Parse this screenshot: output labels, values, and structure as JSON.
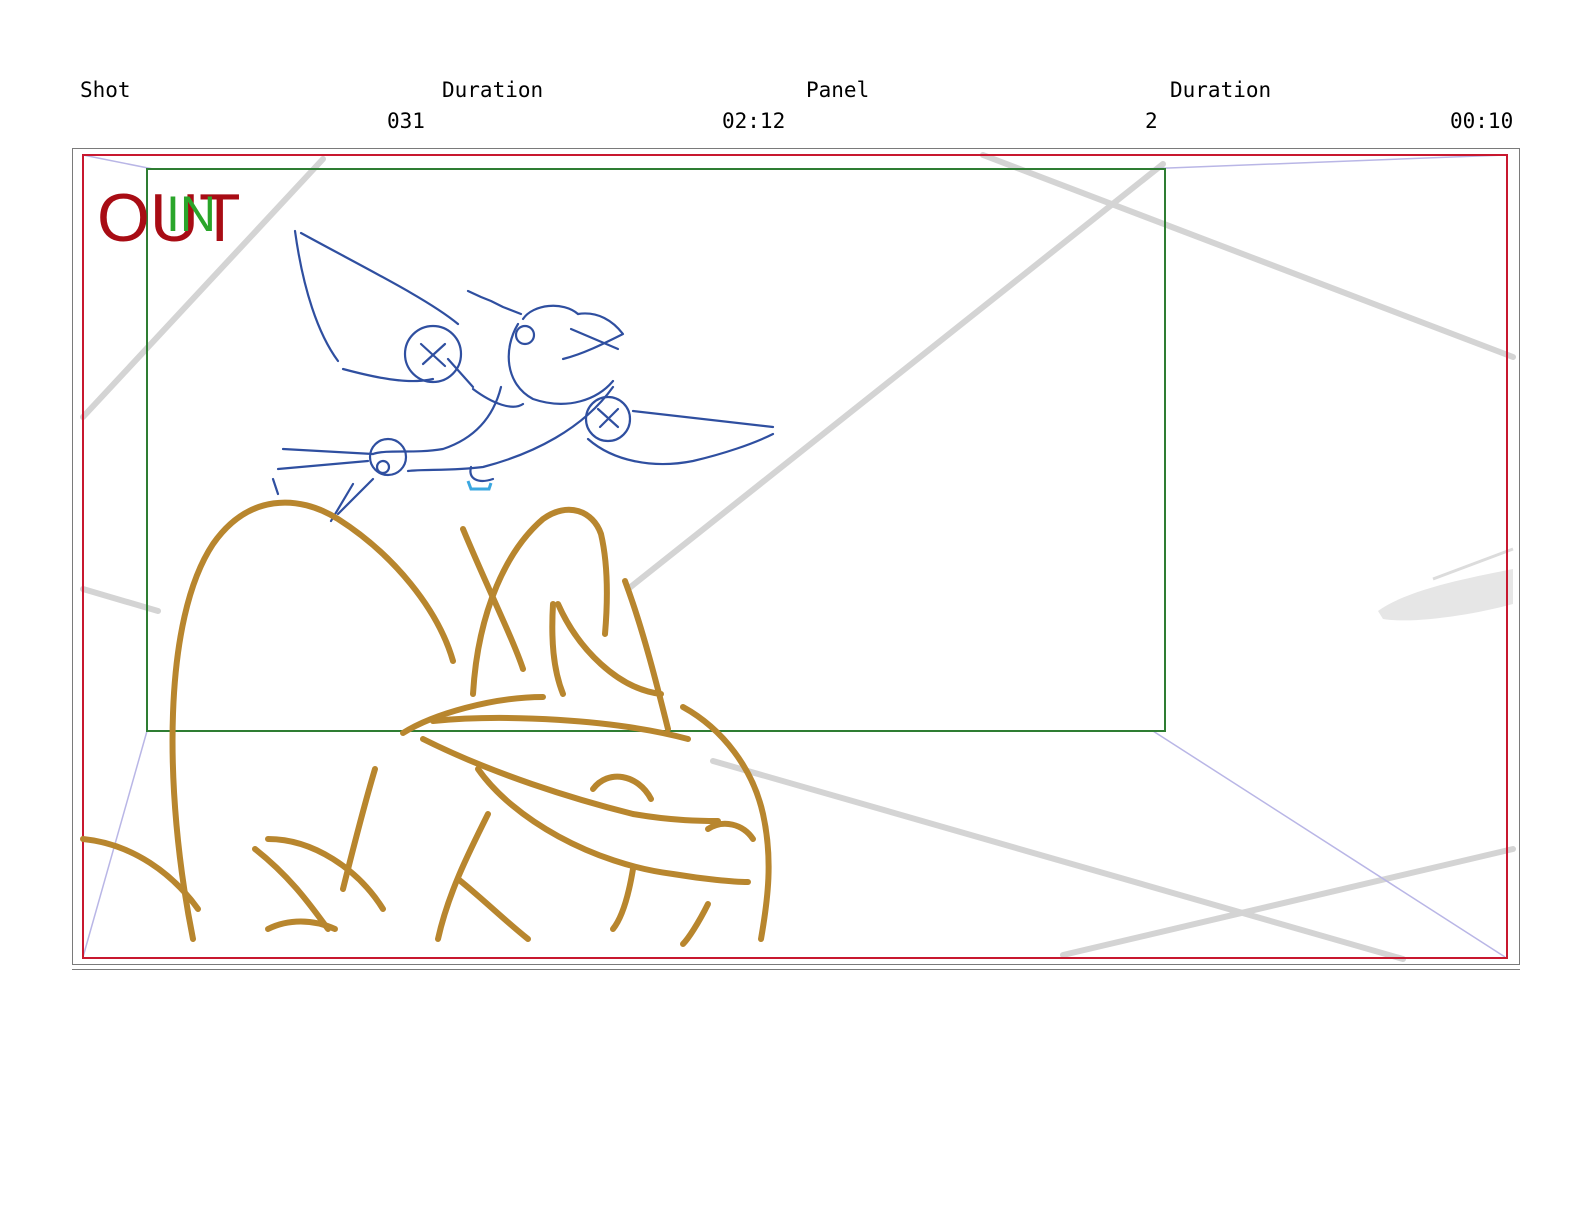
{
  "header": {
    "shot_label": "Shot",
    "shot_duration_label": "Duration",
    "panel_label": "Panel",
    "panel_duration_label": "Duration",
    "shot_value": "031",
    "shot_duration_value": "02:12",
    "panel_value": "2",
    "panel_duration_value": "00:10"
  },
  "panel": {
    "out_mark": "OUT",
    "in_mark": "IN",
    "colors": {
      "safe_frame_red": "#c8182f",
      "camera_frame_green": "#2e7d32",
      "out_text_red": "#a80c14",
      "in_text_green": "#2aa52a",
      "bird_sketch_blue": "#2f4fa0",
      "foreground_sketch_gold": "#b8862e",
      "background_lines_gray": "#d4d4d4",
      "guide_lines_lavender": "#b9b6e6"
    }
  }
}
